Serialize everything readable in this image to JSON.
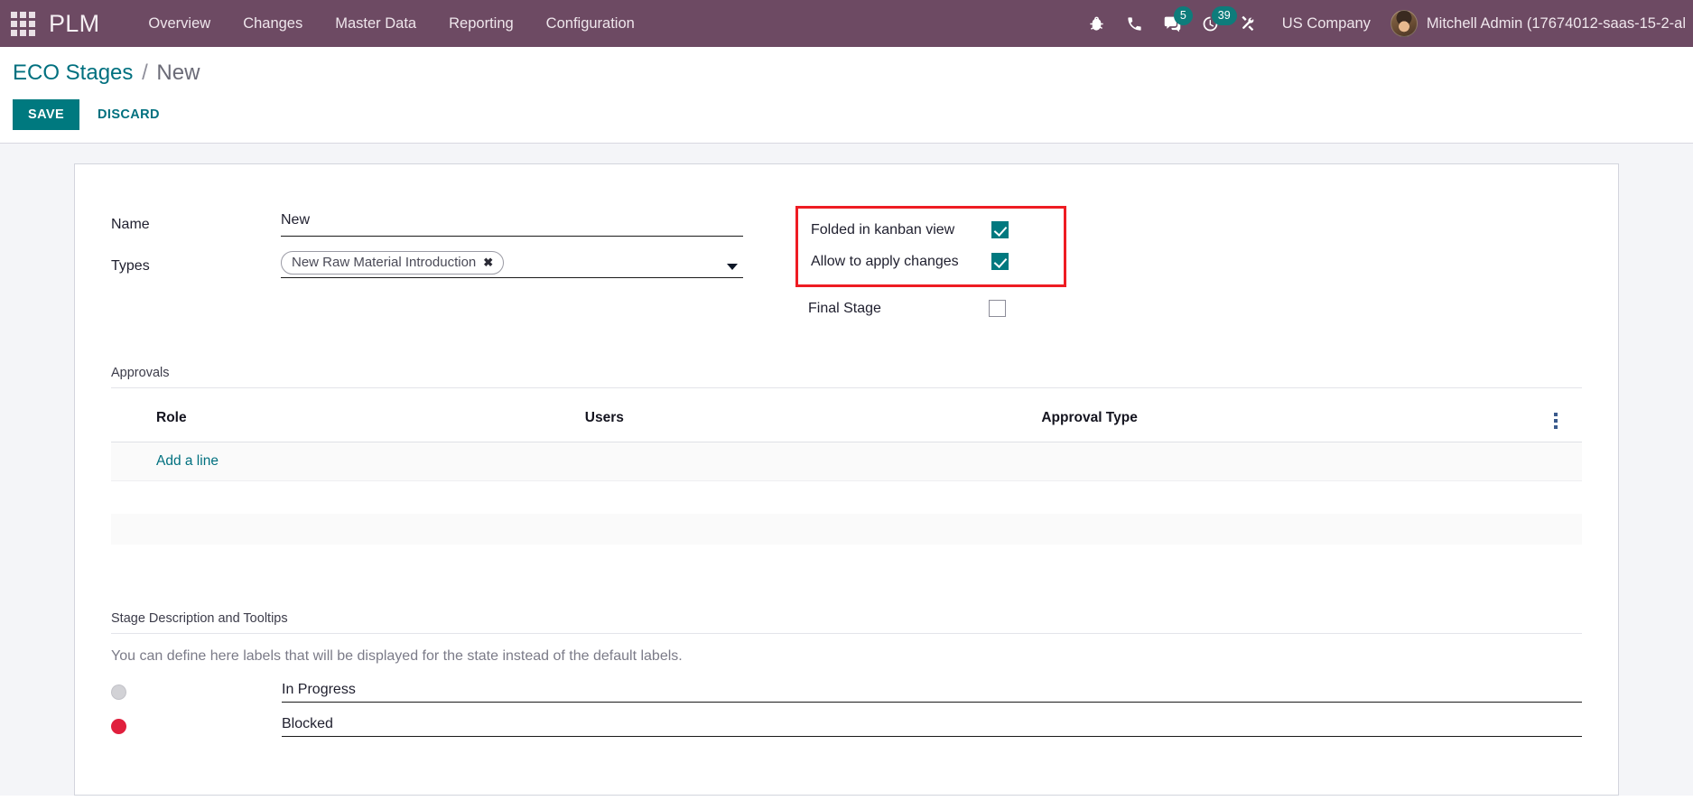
{
  "navbar": {
    "apps_icon": "apps-grid-icon",
    "brand": "PLM",
    "menu": [
      {
        "label": "Overview"
      },
      {
        "label": "Changes"
      },
      {
        "label": "Master Data"
      },
      {
        "label": "Reporting"
      },
      {
        "label": "Configuration"
      }
    ],
    "icons": [
      {
        "name": "bug-icon",
        "badge": null
      },
      {
        "name": "phone-icon",
        "badge": null
      },
      {
        "name": "messages-icon",
        "badge": "5"
      },
      {
        "name": "activity-clock-icon",
        "badge": "39"
      },
      {
        "name": "tools-icon",
        "badge": null
      }
    ],
    "company": "US Company",
    "user_name": "Mitchell Admin (17674012-saas-15-2-al",
    "avatar_name": "user-avatar"
  },
  "breadcrumb": {
    "root": "ECO Stages",
    "separator": "/",
    "current": "New"
  },
  "control_panel": {
    "save_label": "SAVE",
    "discard_label": "DISCARD"
  },
  "form": {
    "name_label": "Name",
    "name_value": "New",
    "name_placeholder": "",
    "types_label": "Types",
    "types_tags": [
      {
        "label": "New Raw Material Introduction",
        "remove": "✖"
      }
    ],
    "checkboxes": [
      {
        "label": "Folded in kanban view",
        "checked": true,
        "highlighted": true
      },
      {
        "label": "Allow to apply changes",
        "checked": true,
        "highlighted": true
      },
      {
        "label": "Final Stage",
        "checked": false,
        "highlighted": false
      }
    ]
  },
  "approvals": {
    "title": "Approvals",
    "columns": [
      "Role",
      "Users",
      "Approval Type"
    ],
    "optional_columns_icon": "kebab-menu-icon",
    "rows": [],
    "add_line_label": "Add a line"
  },
  "stage_description": {
    "title": "Stage Description and Tooltips",
    "help_text": "You can define here labels that will be displayed for the state instead of the default labels.",
    "legends": [
      {
        "dot": "grey",
        "value": "In Progress",
        "name": "legend-normal"
      },
      {
        "dot": "red",
        "value": "Blocked",
        "name": "legend-blocked"
      }
    ]
  },
  "colors": {
    "navbar_bg": "#6d4a63",
    "accent_teal": "#00797f",
    "badge_teal": "#0e7c7b",
    "highlight_red": "#ee1c23",
    "blocked_red": "#e01f3d",
    "form_bg": "#f4f5f8"
  }
}
